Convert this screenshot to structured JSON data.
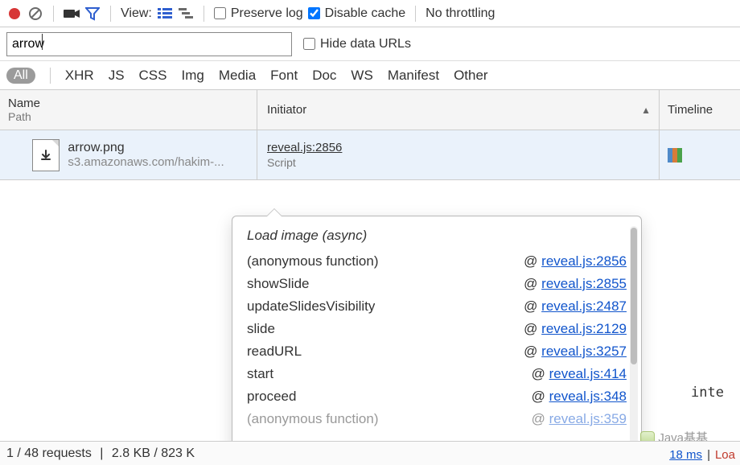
{
  "toolbar": {
    "record": "record",
    "clear": "clear",
    "camera": "screenshots",
    "filter": "filter",
    "view_label": "View:",
    "preserve_log": "Preserve log",
    "disable_cache": "Disable cache",
    "throttling": "No throttling",
    "preserve_log_checked": false,
    "disable_cache_checked": true
  },
  "filterRow": {
    "filter_value": "arrow",
    "hide_data_urls": "Hide data URLs",
    "hide_data_urls_checked": false
  },
  "typeFilters": {
    "all": "All",
    "items": [
      "XHR",
      "JS",
      "CSS",
      "Img",
      "Media",
      "Font",
      "Doc",
      "WS",
      "Manifest",
      "Other"
    ]
  },
  "columns": {
    "name": "Name",
    "path": "Path",
    "initiator": "Initiator",
    "timeline": "Timeline"
  },
  "request": {
    "name": "arrow.png",
    "host": "s3.amazonaws.com/hakim-...",
    "initiator_link": "reveal.js:2856",
    "initiator_type": "Script"
  },
  "popover": {
    "title": "Load image (async)",
    "stack": [
      {
        "fn": "(anonymous function)",
        "at": "@",
        "file": "reveal.js:2856"
      },
      {
        "fn": "showSlide",
        "at": "@",
        "file": "reveal.js:2855"
      },
      {
        "fn": "updateSlidesVisibility",
        "at": "@",
        "file": "reveal.js:2487"
      },
      {
        "fn": "slide",
        "at": "@",
        "file": "reveal.js:2129"
      },
      {
        "fn": "readURL",
        "at": "@",
        "file": "reveal.js:3257"
      },
      {
        "fn": "start",
        "at": "@",
        "file": "reveal.js:414"
      },
      {
        "fn": "proceed",
        "at": "@",
        "file": "reveal.js:348"
      },
      {
        "fn": "(anonymous function)",
        "at": "@",
        "file": "reveal.js:359"
      }
    ]
  },
  "status": {
    "requests": "1 / 48 requests",
    "size": "2.8 KB / 823 K",
    "time_ms": "18 ms",
    "loa": "Loa"
  },
  "watermark": "Java基基",
  "inte": "inte"
}
